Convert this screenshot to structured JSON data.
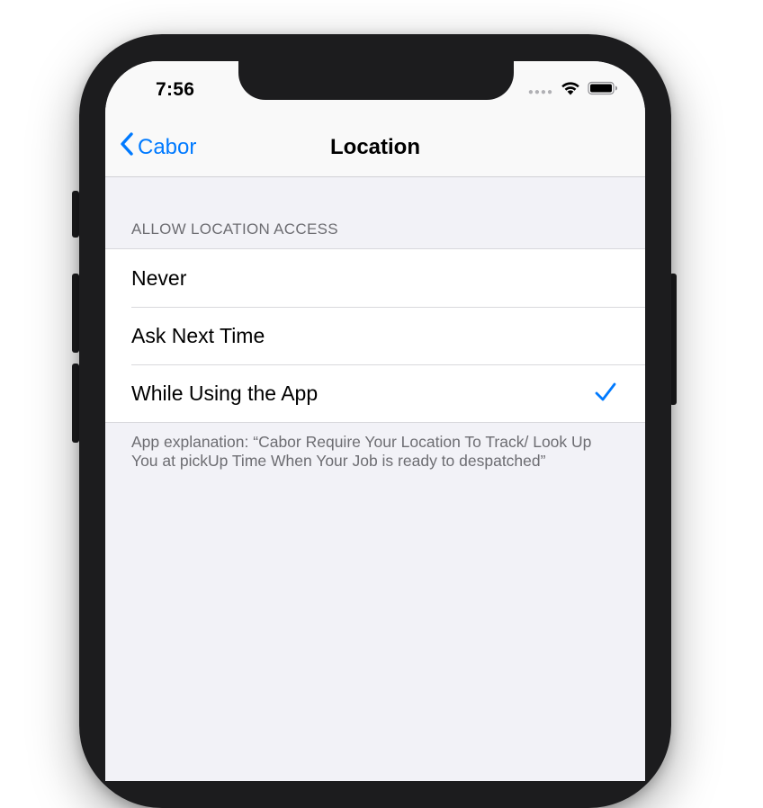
{
  "status": {
    "time": "7:56"
  },
  "nav": {
    "back_label": "Cabor",
    "title": "Location"
  },
  "section": {
    "header": "ALLOW LOCATION ACCESS",
    "options": [
      {
        "label": "Never",
        "selected": false
      },
      {
        "label": "Ask Next Time",
        "selected": false
      },
      {
        "label": "While Using the App",
        "selected": true
      }
    ],
    "footer": "App explanation: “Cabor  Require Your Location To Track/ Look Up You at pickUp Time When Your Job is ready to despatched”"
  },
  "colors": {
    "accent": "#007aff",
    "background": "#f2f2f7",
    "frame": "#1c1c1e"
  },
  "icons": {
    "back": "chevron-left-icon",
    "check": "checkmark-icon",
    "wifi": "wifi-icon",
    "battery": "battery-icon",
    "signal": "cellular-signal-icon"
  }
}
